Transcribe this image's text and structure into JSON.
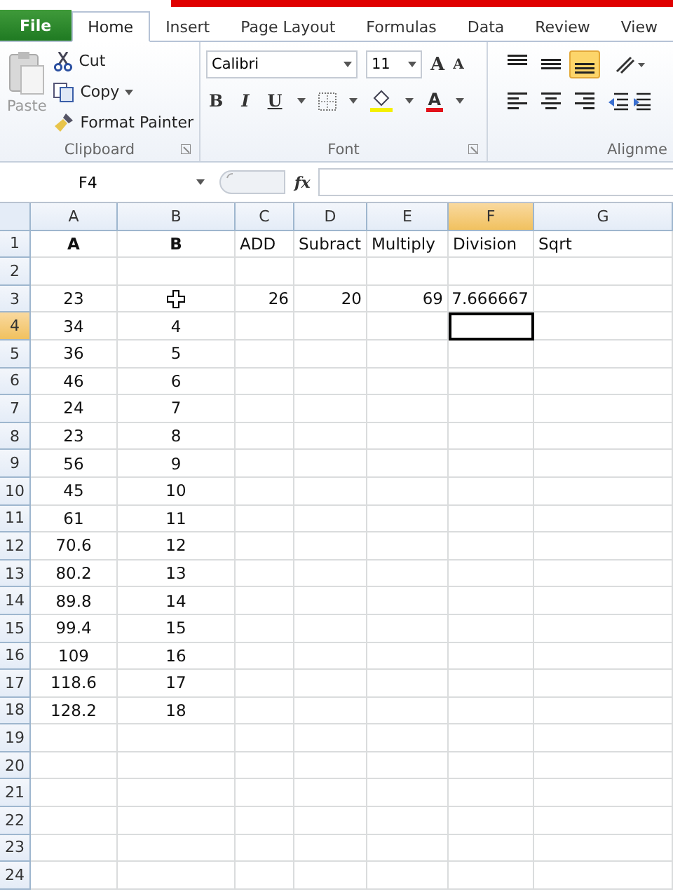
{
  "tabs": [
    {
      "label": "File",
      "kind": "file",
      "selected": false
    },
    {
      "label": "Home",
      "kind": "tab",
      "selected": true
    },
    {
      "label": "Insert",
      "kind": "tab",
      "selected": false
    },
    {
      "label": "Page Layout",
      "kind": "tab",
      "selected": false
    },
    {
      "label": "Formulas",
      "kind": "tab",
      "selected": false
    },
    {
      "label": "Data",
      "kind": "tab",
      "selected": false
    },
    {
      "label": "Review",
      "kind": "tab",
      "selected": false
    },
    {
      "label": "View",
      "kind": "tab",
      "selected": false
    }
  ],
  "clipboard": {
    "paste": "Paste",
    "cut": "Cut",
    "copy": "Copy",
    "format_painter": "Format Painter",
    "label": "Clipboard"
  },
  "font": {
    "name": "Calibri",
    "size": "11",
    "grow": "A",
    "shrink": "A",
    "bold": "B",
    "italic": "I",
    "underline": "U",
    "color_button": "A",
    "label": "Font"
  },
  "alignment": {
    "label": "Alignme",
    "vertical": [
      {
        "kind": "top",
        "selected": false
      },
      {
        "kind": "middle",
        "selected": false
      },
      {
        "kind": "bottom",
        "selected": true
      }
    ]
  },
  "formula_bar": {
    "name_box": "F4",
    "fx": "fx"
  },
  "columns": [
    {
      "label": "A",
      "selected": false
    },
    {
      "label": "B",
      "selected": false
    },
    {
      "label": "C",
      "selected": false
    },
    {
      "label": "D",
      "selected": false
    },
    {
      "label": "E",
      "selected": false
    },
    {
      "label": "F",
      "selected": true
    },
    {
      "label": "G",
      "selected": false
    }
  ],
  "rows": [
    {
      "number": "1",
      "kind": "header",
      "selected": false,
      "cells": [
        "A",
        "B",
        "ADD",
        "Subract",
        "Multiply",
        "Division",
        "Sqrt"
      ]
    },
    {
      "number": "2",
      "kind": "data",
      "selected": false,
      "cells": [
        "",
        "",
        "",
        "",
        "",
        "",
        ""
      ]
    },
    {
      "number": "3",
      "kind": "data",
      "selected": false,
      "cells": [
        "23",
        "",
        "26",
        "20",
        "69",
        "7.666667",
        ""
      ]
    },
    {
      "number": "4",
      "kind": "data",
      "selected": true,
      "cells": [
        "34",
        "4",
        "",
        "",
        "",
        "",
        ""
      ]
    },
    {
      "number": "5",
      "kind": "data",
      "selected": false,
      "cells": [
        "36",
        "5",
        "",
        "",
        "",
        "",
        ""
      ]
    },
    {
      "number": "6",
      "kind": "data",
      "selected": false,
      "cells": [
        "46",
        "6",
        "",
        "",
        "",
        "",
        ""
      ]
    },
    {
      "number": "7",
      "kind": "data",
      "selected": false,
      "cells": [
        "24",
        "7",
        "",
        "",
        "",
        "",
        ""
      ]
    },
    {
      "number": "8",
      "kind": "data",
      "selected": false,
      "cells": [
        "23",
        "8",
        "",
        "",
        "",
        "",
        ""
      ]
    },
    {
      "number": "9",
      "kind": "data",
      "selected": false,
      "cells": [
        "56",
        "9",
        "",
        "",
        "",
        "",
        ""
      ]
    },
    {
      "number": "10",
      "kind": "data",
      "selected": false,
      "cells": [
        "45",
        "10",
        "",
        "",
        "",
        "",
        ""
      ]
    },
    {
      "number": "11",
      "kind": "data",
      "selected": false,
      "cells": [
        "61",
        "11",
        "",
        "",
        "",
        "",
        ""
      ]
    },
    {
      "number": "12",
      "kind": "data",
      "selected": false,
      "cells": [
        "70.6",
        "12",
        "",
        "",
        "",
        "",
        ""
      ]
    },
    {
      "number": "13",
      "kind": "data",
      "selected": false,
      "cells": [
        "80.2",
        "13",
        "",
        "",
        "",
        "",
        ""
      ]
    },
    {
      "number": "14",
      "kind": "data",
      "selected": false,
      "cells": [
        "89.8",
        "14",
        "",
        "",
        "",
        "",
        ""
      ]
    },
    {
      "number": "15",
      "kind": "data",
      "selected": false,
      "cells": [
        "99.4",
        "15",
        "",
        "",
        "",
        "",
        ""
      ]
    },
    {
      "number": "16",
      "kind": "data",
      "selected": false,
      "cells": [
        "109",
        "16",
        "",
        "",
        "",
        "",
        ""
      ]
    },
    {
      "number": "17",
      "kind": "data",
      "selected": false,
      "cells": [
        "118.6",
        "17",
        "",
        "",
        "",
        "",
        ""
      ]
    },
    {
      "number": "18",
      "kind": "data",
      "selected": false,
      "cells": [
        "128.2",
        "18",
        "",
        "",
        "",
        "",
        ""
      ]
    },
    {
      "number": "19",
      "kind": "data",
      "selected": false,
      "cells": [
        "",
        "",
        "",
        "",
        "",
        "",
        ""
      ]
    },
    {
      "number": "20",
      "kind": "data",
      "selected": false,
      "cells": [
        "",
        "",
        "",
        "",
        "",
        "",
        ""
      ]
    },
    {
      "number": "21",
      "kind": "data",
      "selected": false,
      "cells": [
        "",
        "",
        "",
        "",
        "",
        "",
        ""
      ]
    },
    {
      "number": "22",
      "kind": "data",
      "selected": false,
      "cells": [
        "",
        "",
        "",
        "",
        "",
        "",
        ""
      ]
    },
    {
      "number": "23",
      "kind": "data",
      "selected": false,
      "cells": [
        "",
        "",
        "",
        "",
        "",
        "",
        ""
      ]
    },
    {
      "number": "24",
      "kind": "data",
      "selected": false,
      "cells": [
        "",
        "",
        "",
        "",
        "",
        "",
        ""
      ]
    }
  ]
}
